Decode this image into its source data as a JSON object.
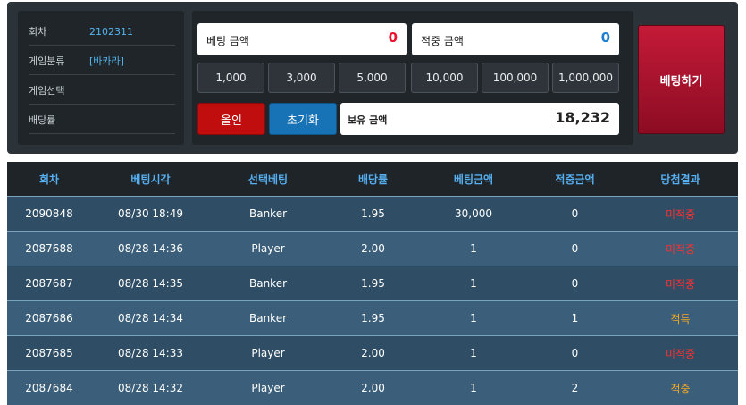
{
  "info": {
    "round_label": "회차",
    "round_value": "2102311",
    "category_label": "게임분류",
    "category_value": "[바카라]",
    "selection_label": "게임선택",
    "selection_value": "",
    "odds_label": "배당률",
    "odds_value": ""
  },
  "bet": {
    "amount_label": "베팅 금액",
    "amount_value": "0",
    "win_label": "적중 금액",
    "win_value": "0",
    "chips": [
      "1,000",
      "3,000",
      "5,000",
      "10,000",
      "100,000",
      "1,000,000"
    ],
    "allin_label": "올인",
    "reset_label": "초기화",
    "holding_label": "보유 금액",
    "holding_value": "18,232",
    "submit_label": "베팅하기"
  },
  "colors": {
    "accent_blue": "#56aff0",
    "lose_red": "#ff2f2f",
    "win_orange": "#f4a820",
    "bet_red": "#c41a38"
  },
  "history": {
    "headers": [
      "회차",
      "베팅시각",
      "선택베팅",
      "배당률",
      "베팅금액",
      "적중금액",
      "당첨결과"
    ],
    "rows": [
      [
        "2090848",
        "08/30 18:49",
        "Banker",
        "1.95",
        "30,000",
        "0",
        "미적중"
      ],
      [
        "2087688",
        "08/28 14:36",
        "Player",
        "2.00",
        "1",
        "0",
        "미적중"
      ],
      [
        "2087687",
        "08/28 14:35",
        "Banker",
        "1.95",
        "1",
        "0",
        "미적중"
      ],
      [
        "2087686",
        "08/28 14:34",
        "Banker",
        "1.95",
        "1",
        "1",
        "적특"
      ],
      [
        "2087685",
        "08/28 14:33",
        "Player",
        "2.00",
        "1",
        "0",
        "미적중"
      ],
      [
        "2087684",
        "08/28 14:32",
        "Player",
        "2.00",
        "1",
        "2",
        "적중"
      ]
    ],
    "result_types": [
      "lose",
      "lose",
      "lose",
      "win",
      "lose",
      "win"
    ]
  }
}
